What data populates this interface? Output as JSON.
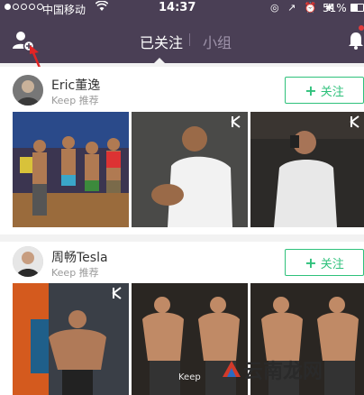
{
  "status_bar": {
    "carrier": "中国移动",
    "time": "14:37",
    "battery": "51%",
    "battery_level": 0.51
  },
  "nav": {
    "tab_following": "已关注",
    "tab_groups": "小组",
    "active_tab": "已关注"
  },
  "feed": [
    {
      "name": "Eric董逸",
      "sub": "Keep 推荐",
      "follow_label": "关注"
    },
    {
      "name": "周畅Tesla",
      "sub": "Keep 推荐",
      "follow_label": "关注"
    }
  ],
  "photos": {
    "keep_text": "Keep"
  },
  "watermark": {
    "text": "云南龙网"
  },
  "colors": {
    "header_bg": "#4a3f55",
    "accent": "#2ec17b",
    "arrow": "#e02525"
  }
}
